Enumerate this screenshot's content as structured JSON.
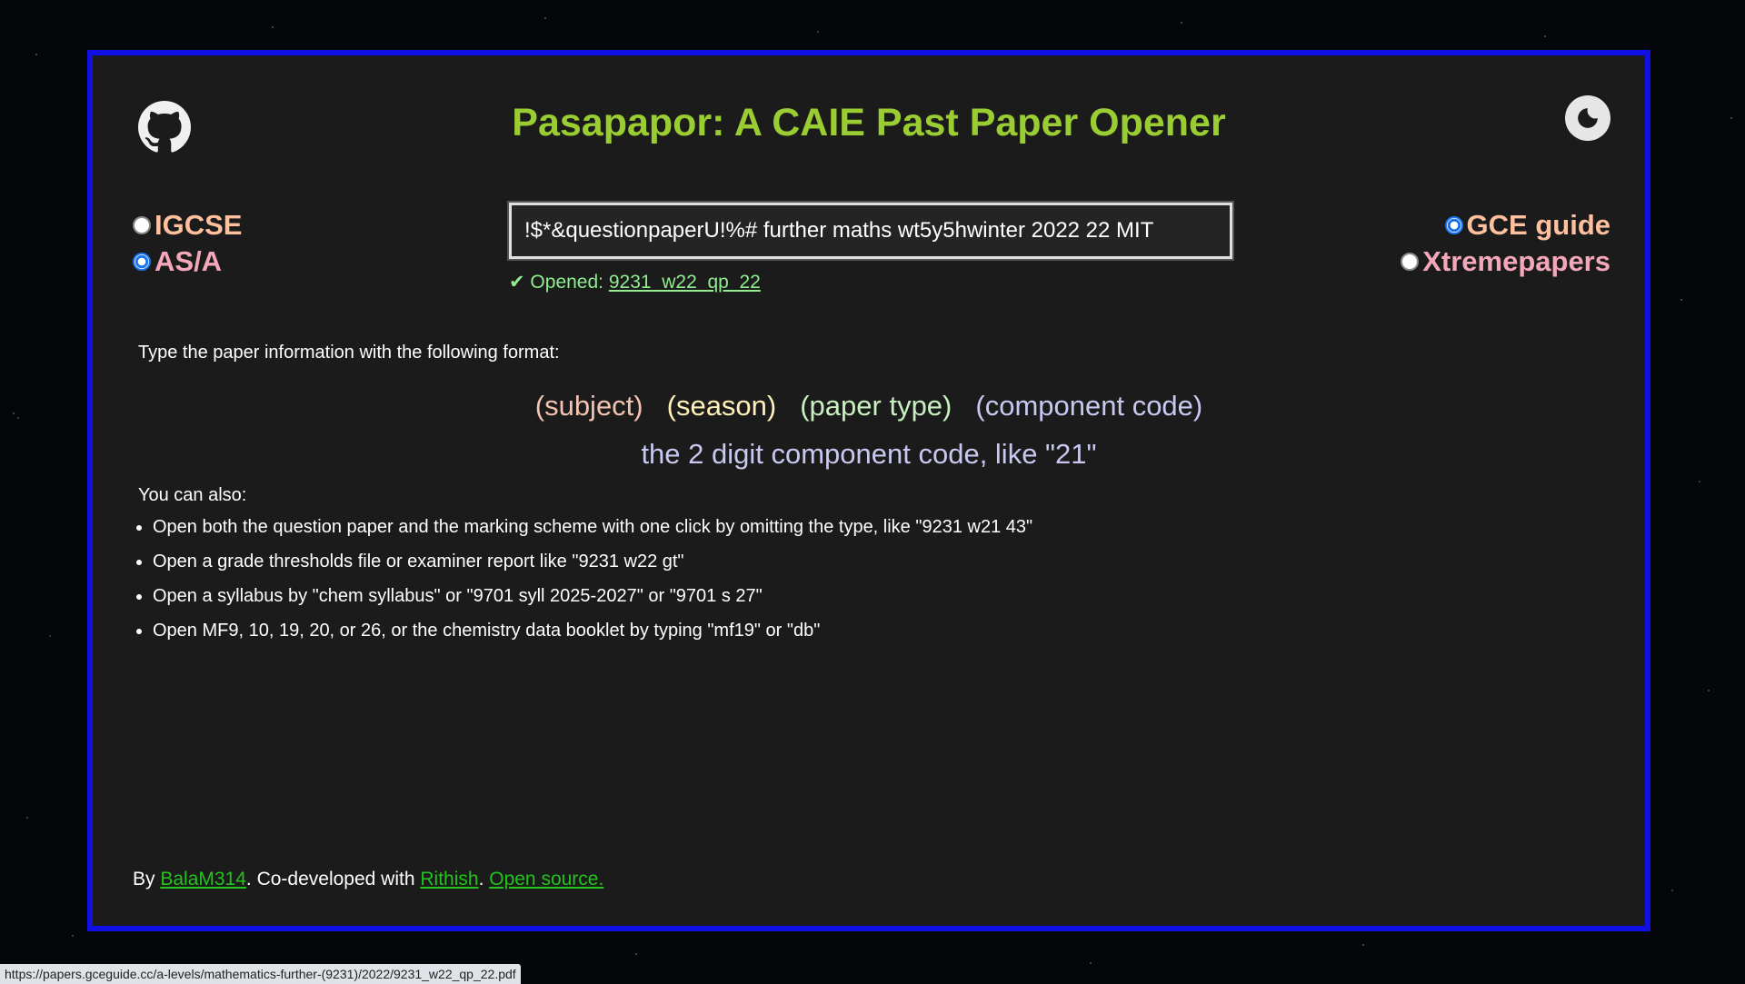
{
  "header": {
    "title": "Pasapapor: A CAIE Past Paper Opener",
    "github_icon": "github-icon",
    "theme_icon": "moon-icon"
  },
  "level": {
    "options": [
      {
        "label": "IGCSE",
        "checked": false
      },
      {
        "label": "AS/A",
        "checked": true
      }
    ]
  },
  "source": {
    "options": [
      {
        "label": "GCE guide",
        "checked": true
      },
      {
        "label": "Xtremepapers",
        "checked": false
      }
    ]
  },
  "search": {
    "value": "!$*&questionpaperU!%# further maths wt5y5hwinter 2022 22 MIT"
  },
  "status": {
    "prefix": "✔ Opened: ",
    "link_text": "9231_w22_qp_22"
  },
  "help": {
    "intro": "Type the paper information with the following format:",
    "format": {
      "subject": "(subject)",
      "season": "(season)",
      "paper_type": "(paper type)",
      "component": "(component code)"
    },
    "component_hint": "the 2 digit component code, like \"21\"",
    "also": "You can also:",
    "tips": [
      "Open both the question paper and the marking scheme with one click by omitting the type, like \"9231 w21 43\"",
      "Open a grade thresholds file or examiner report like \"9231 w22 gt\"",
      "Open a syllabus by \"chem syllabus\" or \"9701 syll 2025-2027\" or \"9701 s 27\"",
      "Open MF9, 10, 19, 20, or 26, or the chemistry data booklet by typing \"mf19\" or \"db\""
    ]
  },
  "footer": {
    "by": "By ",
    "author": "BalaM314",
    "codev": ". Co-developed with ",
    "coauthor": "Rithish",
    "sep": ". ",
    "open_source": "Open source."
  },
  "browser_status": {
    "url": "https://papers.gceguide.cc/a-levels/mathematics-further-(9231)/2022/9231_w22_qp_22.pdf"
  },
  "colors": {
    "border": "#1010e6",
    "panel": "#1b1b1b",
    "title": "#9acd32",
    "link": "#22c41c"
  }
}
